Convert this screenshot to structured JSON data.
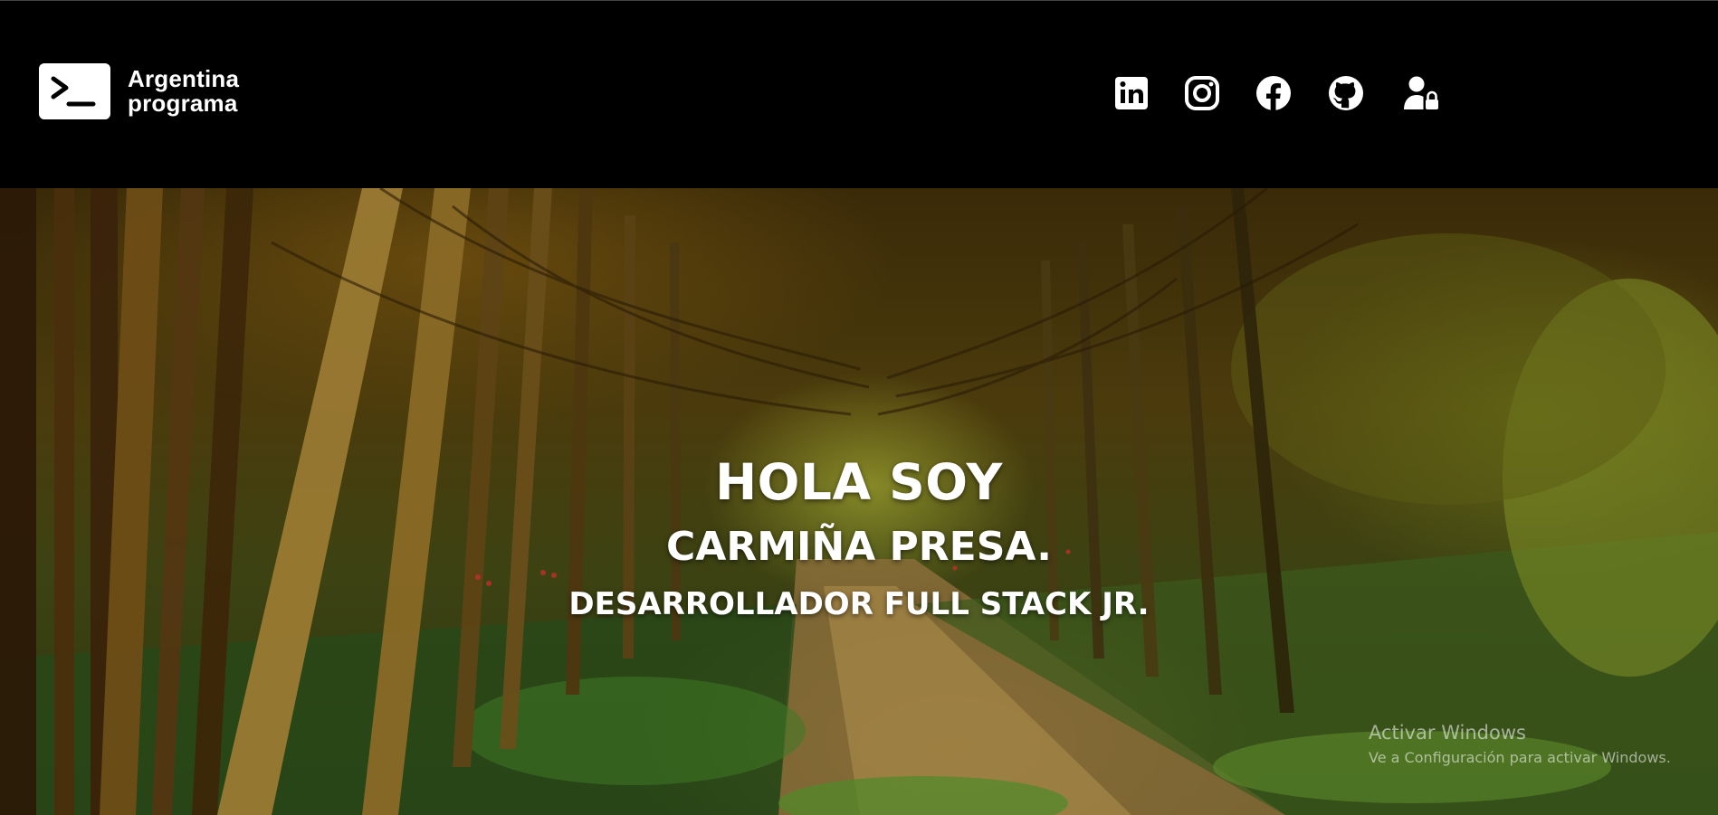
{
  "header": {
    "brand": {
      "line1": "Argentina",
      "line2": "programa",
      "logo_icon": "terminal-prompt-icon"
    },
    "social_links": [
      {
        "name": "linkedin",
        "icon": "linkedin-icon"
      },
      {
        "name": "instagram",
        "icon": "instagram-icon"
      },
      {
        "name": "facebook",
        "icon": "facebook-icon"
      },
      {
        "name": "github",
        "icon": "github-icon"
      },
      {
        "name": "login",
        "icon": "user-lock-icon"
      }
    ]
  },
  "hero": {
    "title": "HOLA SOY",
    "name": "CARMIÑA PRESA.",
    "role": "DESARROLLADOR FULL STACK JR.",
    "background": "forest-path-photo"
  },
  "watermark": {
    "title": "Activar Windows",
    "subtitle": "Ve a Configuración para activar Windows."
  },
  "colors": {
    "header_bg": "#000000",
    "text": "#ffffff"
  }
}
